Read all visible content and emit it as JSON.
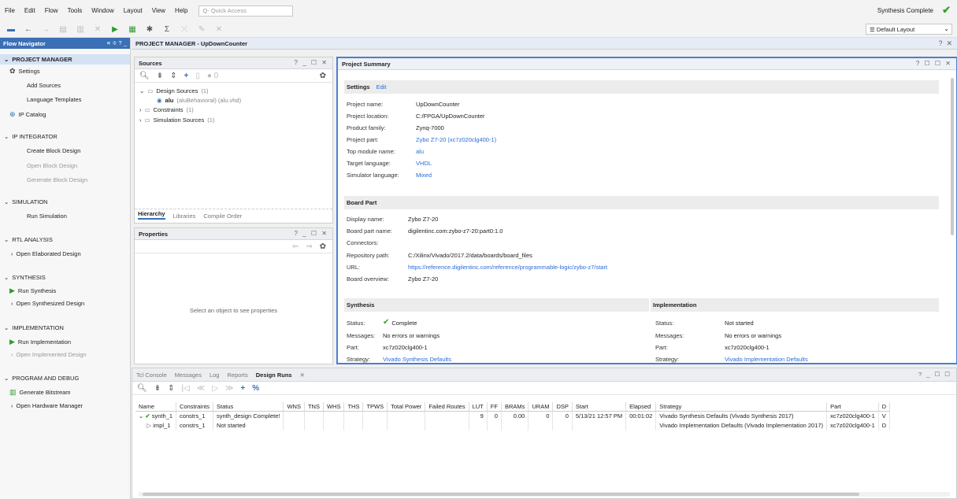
{
  "menu": [
    "File",
    "Edit",
    "Flow",
    "Tools",
    "Window",
    "Layout",
    "View",
    "Help"
  ],
  "quick_access": "Q- Quick Access",
  "status": "Synthesis Complete",
  "layout_select": "Default Layout",
  "flow_nav": {
    "title": "Flow Navigator",
    "controls": "≡ ≑ ? _",
    "sections": {
      "pm": "PROJECT MANAGER",
      "ip": "IP INTEGRATOR",
      "sim": "SIMULATION",
      "rtl": "RTL ANALYSIS",
      "syn": "SYNTHESIS",
      "impl": "IMPLEMENTATION",
      "prog": "PROGRAM AND DEBUG"
    },
    "items": {
      "settings": "Settings",
      "add_sources": "Add Sources",
      "lang_templates": "Language Templates",
      "ip_catalog": "IP Catalog",
      "create_bd": "Create Block Design",
      "open_bd": "Open Block Design",
      "gen_bd": "Generate Block Design",
      "run_sim": "Run Simulation",
      "open_elab": "Open Elaborated Design",
      "run_syn": "Run Synthesis",
      "open_syn": "Open Synthesized Design",
      "run_impl": "Run Implementation",
      "open_impl": "Open Implemented Design",
      "gen_bit": "Generate Bitstream",
      "open_hw": "Open Hardware Manager"
    }
  },
  "pm_header": "PROJECT MANAGER - UpDownCounter",
  "sources": {
    "title": "Sources",
    "badge": "0",
    "design_sources": "Design Sources",
    "design_count": "(1)",
    "alu_name": "alu",
    "alu_detail": "(aluBehavioral) (alu.vhd)",
    "constraints": "Constraints",
    "constraints_count": "(1)",
    "sim_sources": "Simulation Sources",
    "sim_count": "(1)",
    "tabs": [
      "Hierarchy",
      "Libraries",
      "Compile Order"
    ]
  },
  "properties": {
    "title": "Properties",
    "empty": "Select an object to see properties"
  },
  "summary": {
    "title": "Project Summary",
    "settings_head": "Settings",
    "edit": "Edit",
    "project_name_k": "Project name:",
    "project_name_v": "UpDownCounter",
    "project_loc_k": "Project location:",
    "project_loc_v": "C:/FPGA/UpDownCounter",
    "product_family_k": "Product family:",
    "product_family_v": "Zynq-7000",
    "project_part_k": "Project part:",
    "project_part_v": "Zybo Z7-20 (xc7z020clg400-1)",
    "top_module_k": "Top module name:",
    "top_module_v": "alu",
    "target_lang_k": "Target language:",
    "target_lang_v": "VHDL",
    "sim_lang_k": "Simulator language:",
    "sim_lang_v": "Mixed",
    "board_head": "Board Part",
    "display_name_k": "Display name:",
    "display_name_v": "Zybo Z7-20",
    "board_part_k": "Board part name:",
    "board_part_v": "digilentinc.com:zybo-z7-20:part0:1.0",
    "connectors_k": "Connectors:",
    "repo_k": "Repository path:",
    "repo_v": "C:/Xilinx/Vivado/2017.2/data/boards/board_files",
    "url_k": "URL:",
    "url_v": "https://reference.digilentinc.com/reference/programmable-logic/zybo-z7/start",
    "overview_k": "Board overview:",
    "overview_v": "Zybo Z7-20",
    "syn_head": "Synthesis",
    "syn_status_k": "Status:",
    "syn_status_v": "Complete",
    "syn_msg_k": "Messages:",
    "syn_msg_v": "No errors or warnings",
    "syn_part_k": "Part:",
    "syn_part_v": "xc7z020clg400-1",
    "syn_strat_k": "Strategy:",
    "syn_strat_v": "Vivado Synthesis Defaults",
    "impl_head": "Implementation",
    "impl_status_k": "Status:",
    "impl_status_v": "Not started",
    "impl_msg_k": "Messages:",
    "impl_msg_v": "No errors or warnings",
    "impl_part_k": "Part:",
    "impl_part_v": "xc7z020clg400-1",
    "impl_strat_k": "Strategy:",
    "impl_strat_v": "Vivado Implementation Defaults"
  },
  "bottom_tabs": [
    "Tcl Console",
    "Messages",
    "Log",
    "Reports",
    "Design Runs"
  ],
  "runs": {
    "headers": [
      "Name",
      "Constraints",
      "Status",
      "WNS",
      "TNS",
      "WHS",
      "THS",
      "TPWS",
      "Total Power",
      "Failed Routes",
      "LUT",
      "FF",
      "BRAMs",
      "URAM",
      "DSP",
      "Start",
      "Elapsed",
      "Strategy",
      "Part",
      "D"
    ],
    "rows": [
      [
        "synth_1",
        "constrs_1",
        "synth_design Complete!",
        "",
        "",
        "",
        "",
        "",
        "",
        "",
        "9",
        "0",
        "0.00",
        "0",
        "0",
        "5/13/21 12:57 PM",
        "00:01:02",
        "Vivado Synthesis Defaults (Vivado Synthesis 2017)",
        "xc7z020clg400-1",
        "V"
      ],
      [
        "impl_1",
        "constrs_1",
        "Not started",
        "",
        "",
        "",
        "",
        "",
        "",
        "",
        "",
        "",
        "",
        "",
        "",
        "",
        "",
        "Vivado Implementation Defaults (Vivado Implementation 2017)",
        "xc7z020clg400-1",
        "D"
      ]
    ]
  }
}
